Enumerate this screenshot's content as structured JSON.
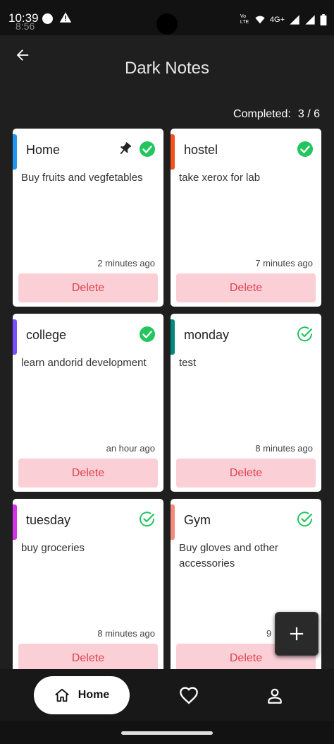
{
  "status_bar": {
    "time": "10:39",
    "ghost_time": "8:56",
    "network": "4G+",
    "volte": "Vo LTE"
  },
  "header": {
    "title": "Dark Notes",
    "back_icon": "arrow-left-icon"
  },
  "summary": {
    "completed_label": "Completed:",
    "completed_value": "3 / 6"
  },
  "notes": [
    {
      "title": "Home",
      "body": "Buy fruits and vegfetables",
      "time": "2 minutes ago",
      "delete_label": "Delete",
      "accent": "#2196f3",
      "pinned": true,
      "done": true
    },
    {
      "title": "hostel",
      "body": "take xerox for lab",
      "time": "7 minutes ago",
      "delete_label": "Delete",
      "accent": "#f4511e",
      "pinned": false,
      "done": true
    },
    {
      "title": "college",
      "body": "learn andorid development",
      "time": "an hour ago",
      "delete_label": "Delete",
      "accent": "#7c4dff",
      "pinned": false,
      "done": true
    },
    {
      "title": "monday",
      "body": "test",
      "time": "8 minutes ago",
      "delete_label": "Delete",
      "accent": "#00897b",
      "pinned": false,
      "done": false
    },
    {
      "title": "tuesday",
      "body": "buy groceries",
      "time": "8 minutes ago",
      "delete_label": "Delete",
      "accent": "#d633e8",
      "pinned": false,
      "done": false
    },
    {
      "title": "Gym",
      "body": "Buy gloves and other accessories",
      "time": "9",
      "delete_label": "Delete",
      "accent": "#f48a7a",
      "pinned": false,
      "done": false
    }
  ],
  "fab": {
    "icon": "plus-icon"
  },
  "bottom_nav": {
    "home_label": "Home",
    "home_icon": "home-icon",
    "favorites_icon": "heart-icon",
    "profile_icon": "person-icon"
  },
  "colors": {
    "background": "#1f1f1f",
    "check_green": "#22c55e",
    "delete_bg": "#fbcfd6",
    "delete_text": "#e0404f"
  }
}
